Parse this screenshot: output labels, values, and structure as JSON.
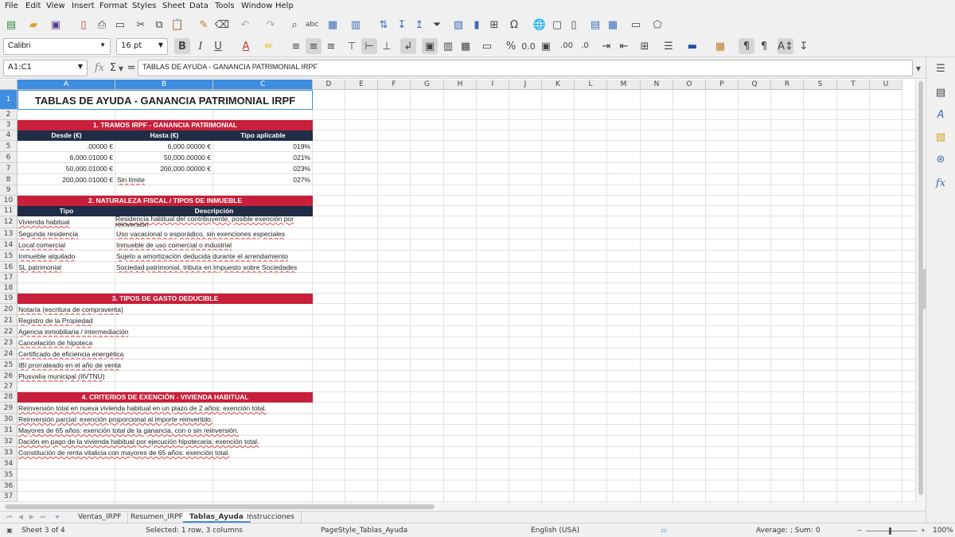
{
  "menubar": {
    "items": [
      "File",
      "Edit",
      "View",
      "Insert",
      "Format",
      "Styles",
      "Sheet",
      "Data",
      "Tools",
      "Window",
      "Help"
    ]
  },
  "toolbar": {
    "font_name": "Calibri",
    "font_size": "16 pt"
  },
  "formula": {
    "name_box": "A1:C1",
    "content": "TABLAS DE AYUDA - GANANCIA PATRIMONIAL IRPF"
  },
  "columns": [
    "A",
    "B",
    "C",
    "D",
    "E",
    "F",
    "G",
    "H",
    "I",
    "J",
    "K",
    "L",
    "M",
    "N",
    "O",
    "P",
    "Q",
    "R",
    "S",
    "T",
    "U"
  ],
  "rows": [
    "1",
    "2",
    "3",
    "4",
    "5",
    "6",
    "7",
    "8",
    "9",
    "10",
    "11",
    "12",
    "13",
    "14",
    "15",
    "16",
    "17",
    "18",
    "19",
    "20",
    "21",
    "22",
    "23",
    "24",
    "25",
    "26",
    "27",
    "28",
    "29",
    "30",
    "31",
    "32",
    "33",
    "34",
    "35",
    "36",
    "37"
  ],
  "sheet": {
    "title": "TABLAS DE AYUDA - GANANCIA PATRIMONIAL IRPF",
    "section1": {
      "title": "1. TRAMOS IRPF - GANANCIA PATRIMONIAL",
      "headers": [
        "Desde (€)",
        "Hasta (€)",
        "Tipo aplicable"
      ],
      "rows": [
        [
          ".00000 €",
          "6,000.00000 €",
          "019%"
        ],
        [
          "6,000.01000 €",
          "50,000.00000 €",
          "021%"
        ],
        [
          "50,000.01000 €",
          "200,000.00000 €",
          "023%"
        ],
        [
          "200,000.01000 €",
          "Sin límite",
          "027%"
        ]
      ]
    },
    "section2": {
      "title": "2. NATURALEZA FISCAL / TIPOS DE INMUEBLE",
      "headers": [
        "Tipo",
        "Descripción"
      ],
      "rows": [
        [
          "Vivienda habitual",
          "Residencia habitual del contribuyente, posible exención por reinversión"
        ],
        [
          "Segunda residencia",
          "Uso vacacional o esporádico, sin exenciones especiales"
        ],
        [
          "Local comercial",
          "Inmueble de uso comercial o industrial"
        ],
        [
          "Inmueble alquilado",
          "Sujeto a amortización deducida durante el arrendamiento"
        ],
        [
          "SL patrimonial",
          "Sociedad patrimonial, tributa en Impuesto sobre Sociedades"
        ]
      ]
    },
    "section3": {
      "title": "3. TIPOS DE GASTO DEDUCIBLE",
      "items": [
        "Notaría (escritura de compraventa)",
        "Registro de la Propiedad",
        "Agencia inmobiliaria / intermediación",
        "Cancelación de hipoteca",
        "Certificado de eficiencia energética",
        "IBI prorrateado en el año de venta",
        "Plusvalía municipal (IIVTNU)"
      ]
    },
    "section4": {
      "title": "4. CRITERIOS DE EXENCIÓN - VIVIENDA HABITUAL",
      "items": [
        "Reinversión total en nueva vivienda habitual en un plazo de 2 años: exención total.",
        "Reinversión parcial: exención proporcional al importe reinvertido.",
        "Mayores de 65 años: exención total de la ganancia, con o sin reinversión.",
        "Dación en pago de la vivienda habitual por ejecución hipotecaria: exención total.",
        "Constitución de renta vitalicia con mayores de 65 años: exención total."
      ]
    }
  },
  "tabs": [
    "Ventas_IRPF",
    "Resumen_IRPF",
    "Tablas_Ayuda",
    "Instrucciones"
  ],
  "status": {
    "sheet": "Sheet 3 of 4",
    "selection": "Selected: 1 row, 3 columns",
    "page_style": "PageStyle_Tablas_Ayuda",
    "language": "English (USA)",
    "summary": "Average: ; Sum: 0",
    "zoom": "100%"
  },
  "colors": {
    "accent": "#3e8de0",
    "section_red": "#c8203a",
    "header_navy": "#1f2d47"
  }
}
